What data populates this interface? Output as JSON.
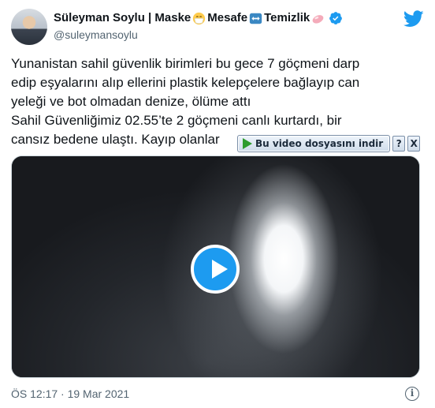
{
  "author": {
    "name_parts": [
      "Süleyman Soylu | Maske",
      " Mesafe",
      " Temizlik"
    ],
    "emojis": [
      "mask-face-emoji",
      "left-right-arrow-emoji",
      "soap-emoji"
    ],
    "verified": true,
    "handle": "@suleymansoylu"
  },
  "brand_icon": "twitter-bird-icon",
  "tweet": {
    "lines": [
      "Yunanistan sahil güvenlik birimleri bu gece 7 göçmeni darp",
      "edip eşyalarını alıp ellerini plastik kelepçelere bağlayıp can",
      "yeleği ve bot olmadan denize, ölüme attı",
      "Sahil Güvenliğimiz 02.55’te 2 göçmeni canlı kurtardı, bir",
      "cansız bedene ulaştı. Kayıp olanlar"
    ]
  },
  "video": {
    "play_icon": "play-icon"
  },
  "download_overlay": {
    "label": "Bu video dosyasını indir",
    "help": "?",
    "close": "X"
  },
  "footer": {
    "timestamp": "ÖS 12:17 · 19 Mar 2021",
    "info_glyph": "i"
  },
  "colors": {
    "accent": "#1d9bf0",
    "text": "#0f1419",
    "secondary_text": "#536471"
  }
}
